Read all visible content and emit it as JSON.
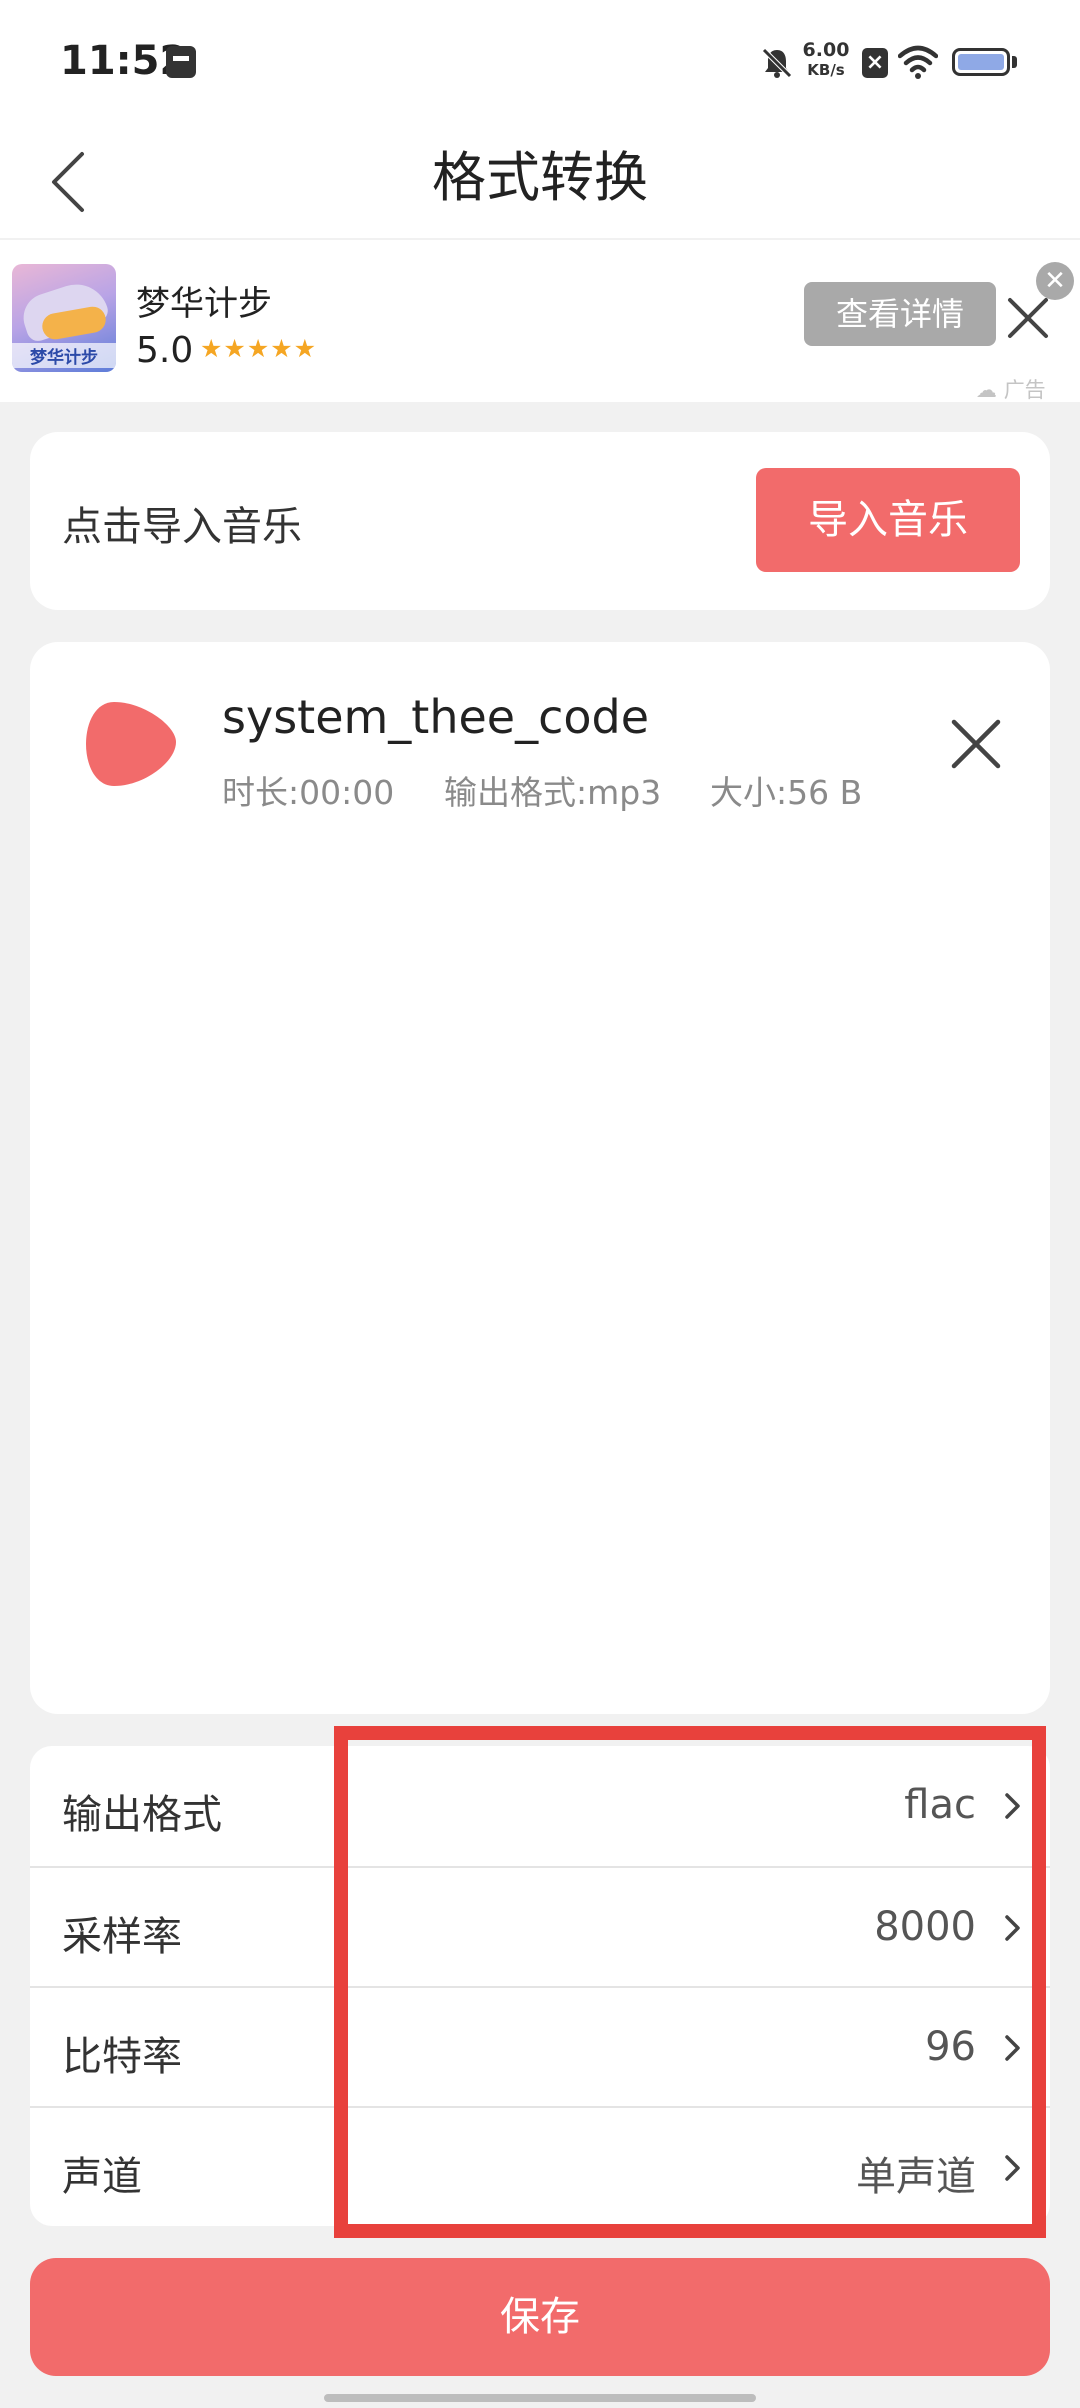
{
  "status_bar": {
    "time": "11:52",
    "net_speed_value": "6.00",
    "net_speed_unit": "KB/s",
    "icons": [
      "storage-icon",
      "bell-mute-icon",
      "blocked-icon",
      "wifi-icon",
      "battery-icon"
    ]
  },
  "nav": {
    "title": "格式转换",
    "back_icon": "chevron-left-icon"
  },
  "ad": {
    "app_name": "梦华计步",
    "icon_text": "梦华计步",
    "rating": "5.0",
    "stars": "★★★★★",
    "detail_button": "查看详情",
    "badge_close": "✕",
    "label": "广告"
  },
  "import": {
    "label": "点击导入音乐",
    "button": "导入音乐"
  },
  "file": {
    "name": "system_thee_code",
    "duration": "时长:00:00",
    "output_format": "输出格式:mp3",
    "size": "大小:56 B"
  },
  "settings": [
    {
      "label": "输出格式",
      "value": "flac"
    },
    {
      "label": "采样率",
      "value": "8000"
    },
    {
      "label": "比特率",
      "value": "96"
    },
    {
      "label": "声道",
      "value": "单声道"
    }
  ],
  "save_button": "保存",
  "colors": {
    "accent": "#f26b6b",
    "highlight": "#e8413c",
    "background": "#f1f1f1"
  }
}
